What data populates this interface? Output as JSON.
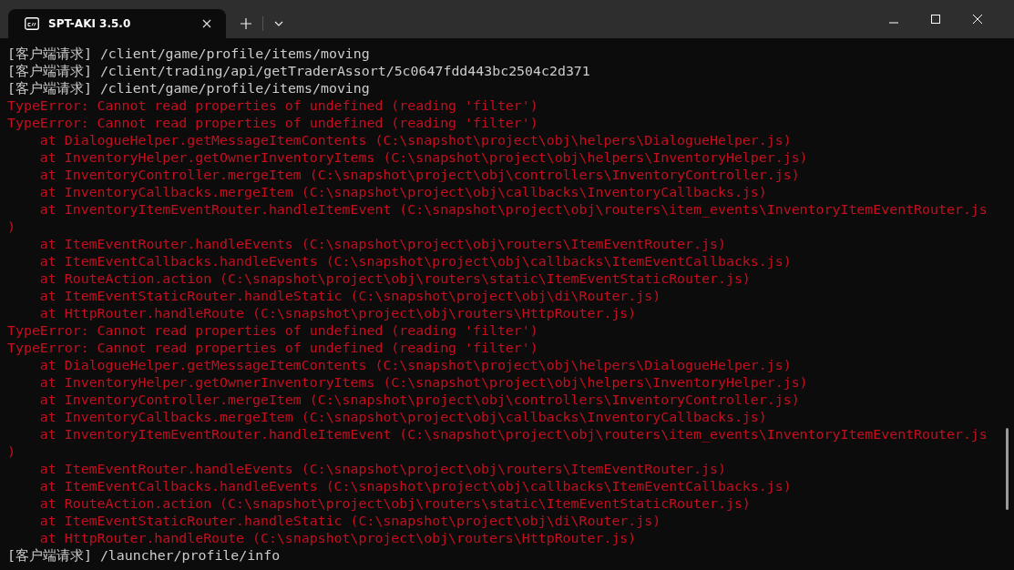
{
  "tab": {
    "title": "SPT-AKI 3.5.0",
    "selected": true
  },
  "lines": [
    {
      "kind": "info",
      "text": "[客户端请求] /client/game/profile/items/moving"
    },
    {
      "kind": "info",
      "text": "[客户端请求] /client/trading/api/getTraderAssort/5c0647fdd443bc2504c2d371"
    },
    {
      "kind": "info",
      "text": "[客户端请求] /client/game/profile/items/moving"
    },
    {
      "kind": "error",
      "text": "TypeError: Cannot read properties of undefined (reading 'filter')"
    },
    {
      "kind": "error",
      "text": "TypeError: Cannot read properties of undefined (reading 'filter')"
    },
    {
      "kind": "error",
      "text": "    at DialogueHelper.getMessageItemContents (C:\\snapshot\\project\\obj\\helpers\\DialogueHelper.js)"
    },
    {
      "kind": "error",
      "text": "    at InventoryHelper.getOwnerInventoryItems (C:\\snapshot\\project\\obj\\helpers\\InventoryHelper.js)"
    },
    {
      "kind": "error",
      "text": "    at InventoryController.mergeItem (C:\\snapshot\\project\\obj\\controllers\\InventoryController.js)"
    },
    {
      "kind": "error",
      "text": "    at InventoryCallbacks.mergeItem (C:\\snapshot\\project\\obj\\callbacks\\InventoryCallbacks.js)"
    },
    {
      "kind": "error",
      "text": "    at InventoryItemEventRouter.handleItemEvent (C:\\snapshot\\project\\obj\\routers\\item_events\\InventoryItemEventRouter.js"
    },
    {
      "kind": "error",
      "text": ")"
    },
    {
      "kind": "error",
      "text": "    at ItemEventRouter.handleEvents (C:\\snapshot\\project\\obj\\routers\\ItemEventRouter.js)"
    },
    {
      "kind": "error",
      "text": "    at ItemEventCallbacks.handleEvents (C:\\snapshot\\project\\obj\\callbacks\\ItemEventCallbacks.js)"
    },
    {
      "kind": "error",
      "text": "    at RouteAction.action (C:\\snapshot\\project\\obj\\routers\\static\\ItemEventStaticRouter.js)"
    },
    {
      "kind": "error",
      "text": "    at ItemEventStaticRouter.handleStatic (C:\\snapshot\\project\\obj\\di\\Router.js)"
    },
    {
      "kind": "error",
      "text": "    at HttpRouter.handleRoute (C:\\snapshot\\project\\obj\\routers\\HttpRouter.js)"
    },
    {
      "kind": "error",
      "text": "TypeError: Cannot read properties of undefined (reading 'filter')"
    },
    {
      "kind": "error",
      "text": "TypeError: Cannot read properties of undefined (reading 'filter')"
    },
    {
      "kind": "error",
      "text": "    at DialogueHelper.getMessageItemContents (C:\\snapshot\\project\\obj\\helpers\\DialogueHelper.js)"
    },
    {
      "kind": "error",
      "text": "    at InventoryHelper.getOwnerInventoryItems (C:\\snapshot\\project\\obj\\helpers\\InventoryHelper.js)"
    },
    {
      "kind": "error",
      "text": "    at InventoryController.mergeItem (C:\\snapshot\\project\\obj\\controllers\\InventoryController.js)"
    },
    {
      "kind": "error",
      "text": "    at InventoryCallbacks.mergeItem (C:\\snapshot\\project\\obj\\callbacks\\InventoryCallbacks.js)"
    },
    {
      "kind": "error",
      "text": "    at InventoryItemEventRouter.handleItemEvent (C:\\snapshot\\project\\obj\\routers\\item_events\\InventoryItemEventRouter.js"
    },
    {
      "kind": "error",
      "text": ")"
    },
    {
      "kind": "error",
      "text": "    at ItemEventRouter.handleEvents (C:\\snapshot\\project\\obj\\routers\\ItemEventRouter.js)"
    },
    {
      "kind": "error",
      "text": "    at ItemEventCallbacks.handleEvents (C:\\snapshot\\project\\obj\\callbacks\\ItemEventCallbacks.js)"
    },
    {
      "kind": "error",
      "text": "    at RouteAction.action (C:\\snapshot\\project\\obj\\routers\\static\\ItemEventStaticRouter.js)"
    },
    {
      "kind": "error",
      "text": "    at ItemEventStaticRouter.handleStatic (C:\\snapshot\\project\\obj\\di\\Router.js)"
    },
    {
      "kind": "error",
      "text": "    at HttpRouter.handleRoute (C:\\snapshot\\project\\obj\\routers\\HttpRouter.js)"
    },
    {
      "kind": "info",
      "text": "[客户端请求] /launcher/profile/info"
    }
  ]
}
